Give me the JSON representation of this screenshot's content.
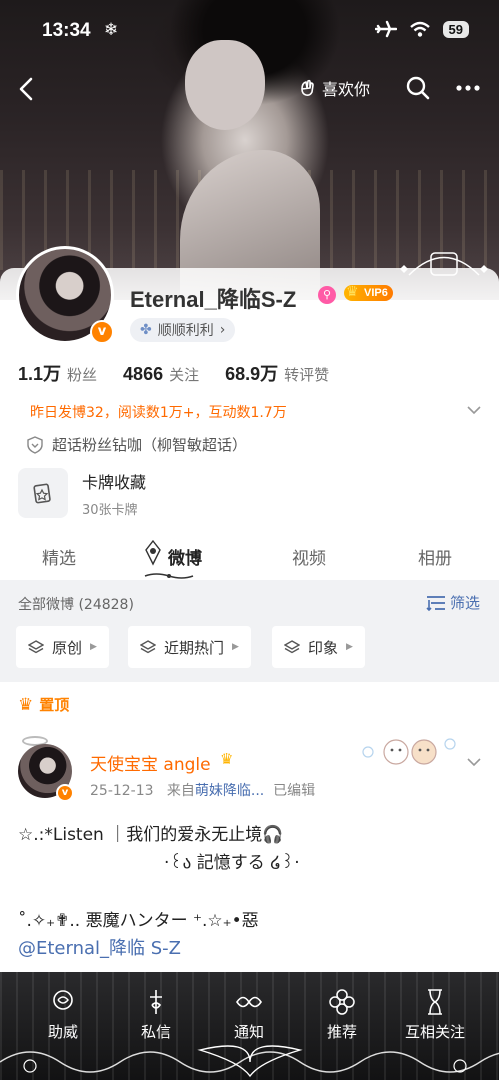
{
  "status_bar": {
    "time": "13:34",
    "battery": "59"
  },
  "topnav": {
    "like_label": "喜欢你"
  },
  "profile": {
    "username": "Eternal_降临S-Z",
    "vip_label": "VIP6",
    "tag_label": "顺顺利利",
    "tag_chevron": "›",
    "stats": [
      {
        "value": "1.1万",
        "label": "粉丝"
      },
      {
        "value": "4866",
        "label": "关注"
      },
      {
        "value": "68.9万",
        "label": "转评赞"
      }
    ],
    "activity": "昨日发博32，阅读数1万+，互动数1.7万",
    "supertopic": "超话粉丝钻咖（柳智敏超话）",
    "card": {
      "title": "卡牌收藏",
      "subtitle": "30张卡牌"
    }
  },
  "tabs": [
    {
      "label": "精选",
      "active": false
    },
    {
      "label": "微博",
      "active": true
    },
    {
      "label": "视频",
      "active": false
    },
    {
      "label": "相册",
      "active": false
    }
  ],
  "feed": {
    "count_label": "全部微博 (24828)",
    "filter_label": "筛选",
    "chips": [
      {
        "label": "原创"
      },
      {
        "label": "近期热门"
      },
      {
        "label": "印象"
      }
    ]
  },
  "post": {
    "pinned_label": "置顶",
    "author": "天使宝宝 angle",
    "date": "25-12-13",
    "source_prefix": "来自",
    "source": "萌妹降临...",
    "edited": "已编辑",
    "lines": [
      "☆.:*Listen ｜我们的爱永无止境🎧",
      "·꒰ა 記憶する ໒꒱·",
      "˚.✧₊✟.. 悪魔ハンター ⁺.☆₊•惡"
    ],
    "mention": "@Eternal_降临 S-Z"
  },
  "bottom_bar": [
    {
      "label": "助威",
      "icon": "cheer-icon"
    },
    {
      "label": "私信",
      "icon": "message-icon"
    },
    {
      "label": "通知",
      "icon": "notify-icon"
    },
    {
      "label": "推荐",
      "icon": "recommend-icon"
    },
    {
      "label": "互相关注",
      "icon": "mutual-follow-icon"
    }
  ],
  "colors": {
    "accent_orange": "#ff8200",
    "link_blue": "#4a6fb0",
    "vip_gold": "#ffb400",
    "bottom_bar_bg": "#1a1a1b"
  }
}
